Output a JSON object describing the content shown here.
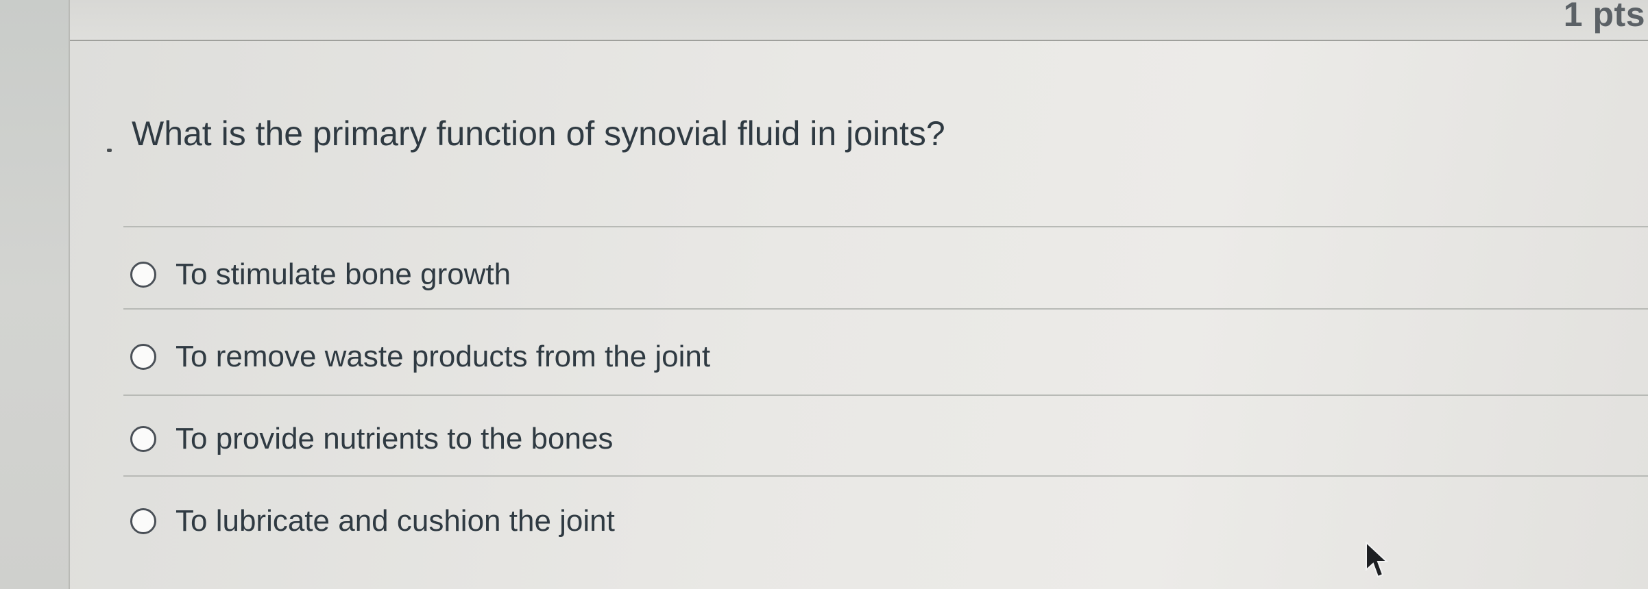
{
  "question": {
    "points_label": "1 pts",
    "text": "What is the primary function of synovial fluid in joints?"
  },
  "answers": [
    {
      "label": "To stimulate bone growth",
      "selected": false
    },
    {
      "label": "To remove waste products from the joint",
      "selected": false
    },
    {
      "label": "To provide nutrients to the bones",
      "selected": false
    },
    {
      "label": "To lubricate and cushion the joint",
      "selected": false
    }
  ],
  "icons": {
    "radio": "radio-unselected-icon",
    "cursor": "mouse-pointer-icon"
  },
  "colors": {
    "text": "#2f3a42",
    "points": "#5b6166",
    "divider": "#b8bab6"
  }
}
